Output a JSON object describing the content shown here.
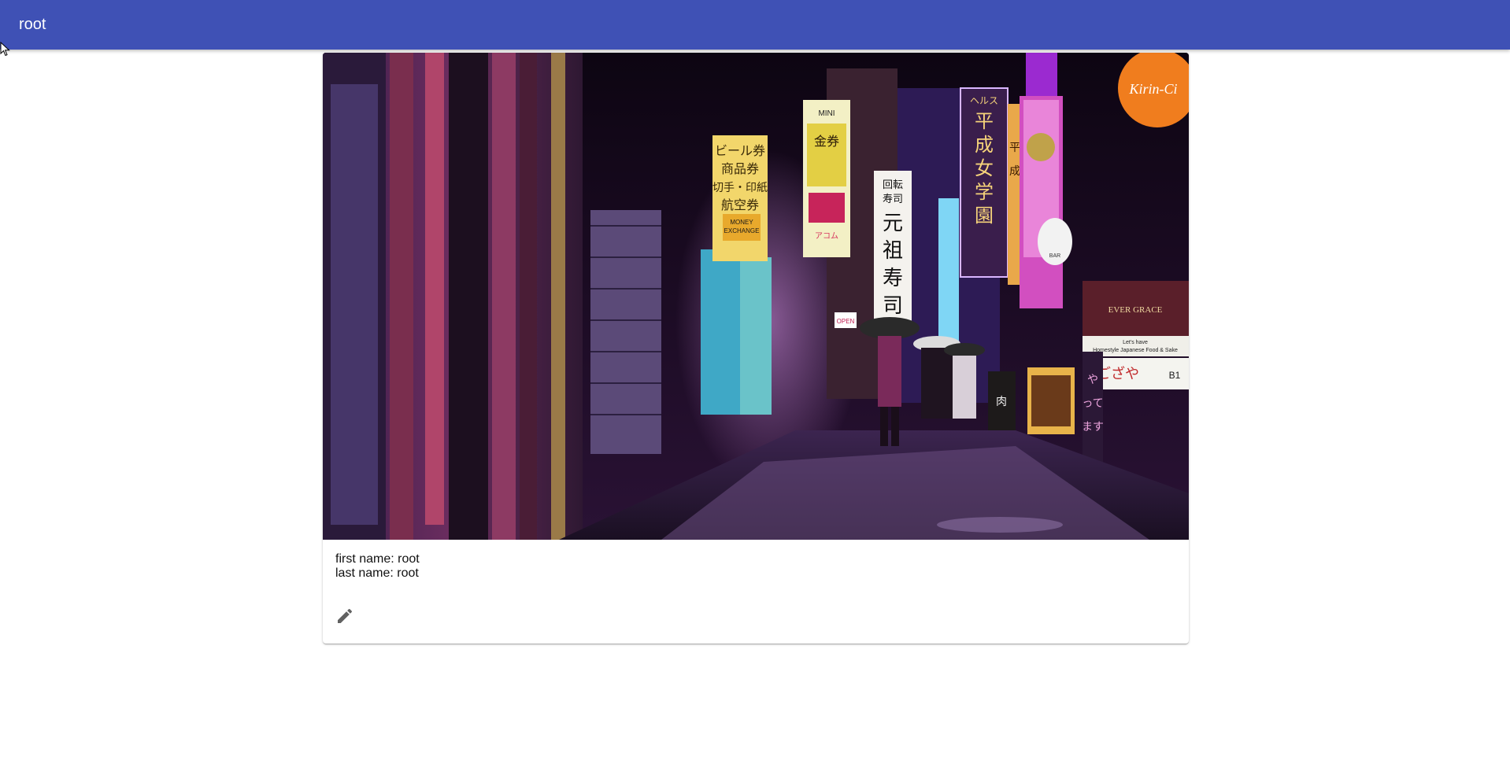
{
  "app_bar": {
    "title": "root"
  },
  "card": {
    "photo": {
      "description_icon": "street-photo",
      "signs": {
        "beer": "ビール券\n商品券\n切手・印紙\n航空券",
        "money": "MONEY\nEXCHANGE",
        "mini": "MINI",
        "kinken": "金券",
        "acom": "アコム",
        "sushi": "回転\n寿司\n元祖寿司",
        "school": "ヘルス\n平成女学園",
        "heisei": "平成",
        "kirin": "Kirin-Ci",
        "bar": "BAR",
        "evergrace": "EVER GRACE",
        "homestyle": "Let's have\nHomestyle Japanese Food & Sake",
        "gozaya": "ござや",
        "b1": "B1",
        "open": "OPEN",
        "yattemasu": "やってます",
        "niku": "肉"
      }
    },
    "first_name_label": "first name: root",
    "last_name_label": "last name: root",
    "edit_icon": "pencil-icon"
  },
  "colors": {
    "app_bar": "#3f51b5",
    "icon": "#616161"
  }
}
